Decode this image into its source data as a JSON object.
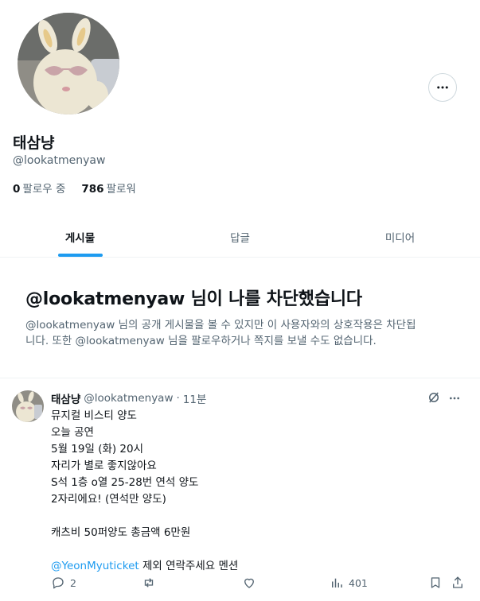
{
  "profile": {
    "display_name": "태삼냥",
    "handle": "@lookatmenyaw",
    "following_count": "0",
    "following_label": "팔로우 중",
    "followers_count": "786",
    "followers_label": "팔로워"
  },
  "tabs": [
    {
      "label": "게시물",
      "active": true
    },
    {
      "label": "답글",
      "active": false
    },
    {
      "label": "미디어",
      "active": false
    }
  ],
  "blocked": {
    "title": "@lookatmenyaw 님이 나를 차단했습니다",
    "description_line1": "@lookatmenyaw 님의 공개 게시물을 볼 수 있지만 이 사용자와의 상호작용은 차단됩",
    "description_line2": "니다. 또한 @lookatmenyaw 님을 팔로우하거나 쪽지를 보낼 수도 없습니다."
  },
  "tweet": {
    "author_name": "태삼냥",
    "author_handle": "@lookatmenyaw",
    "separator": "·",
    "time": "11분",
    "lines": [
      "뮤지컬 비스티 양도",
      "오늘 공연",
      "5월 19일 (화) 20시",
      "자리가 별로 좋지않아요",
      "S석 1층 o열 25-28번 연석 양도",
      "2자리에요! (연석만 양도)",
      "",
      "캐츠비 50퍼양도 총금액 6만원",
      ""
    ],
    "mention": "@YeonMyuticket",
    "mention_suffix": " 제외 연락주세요 멘션",
    "replies": "2",
    "retweets": "",
    "likes": "",
    "views": "401"
  },
  "colors": {
    "accent": "#1d9bf0",
    "secondary_text": "#536471",
    "primary_text": "#0f1419",
    "border": "#eff3f4"
  },
  "icons": [
    "more-icon",
    "grok-icon",
    "reply-icon",
    "retweet-icon",
    "like-icon",
    "views-icon",
    "bookmark-icon",
    "share-icon"
  ]
}
